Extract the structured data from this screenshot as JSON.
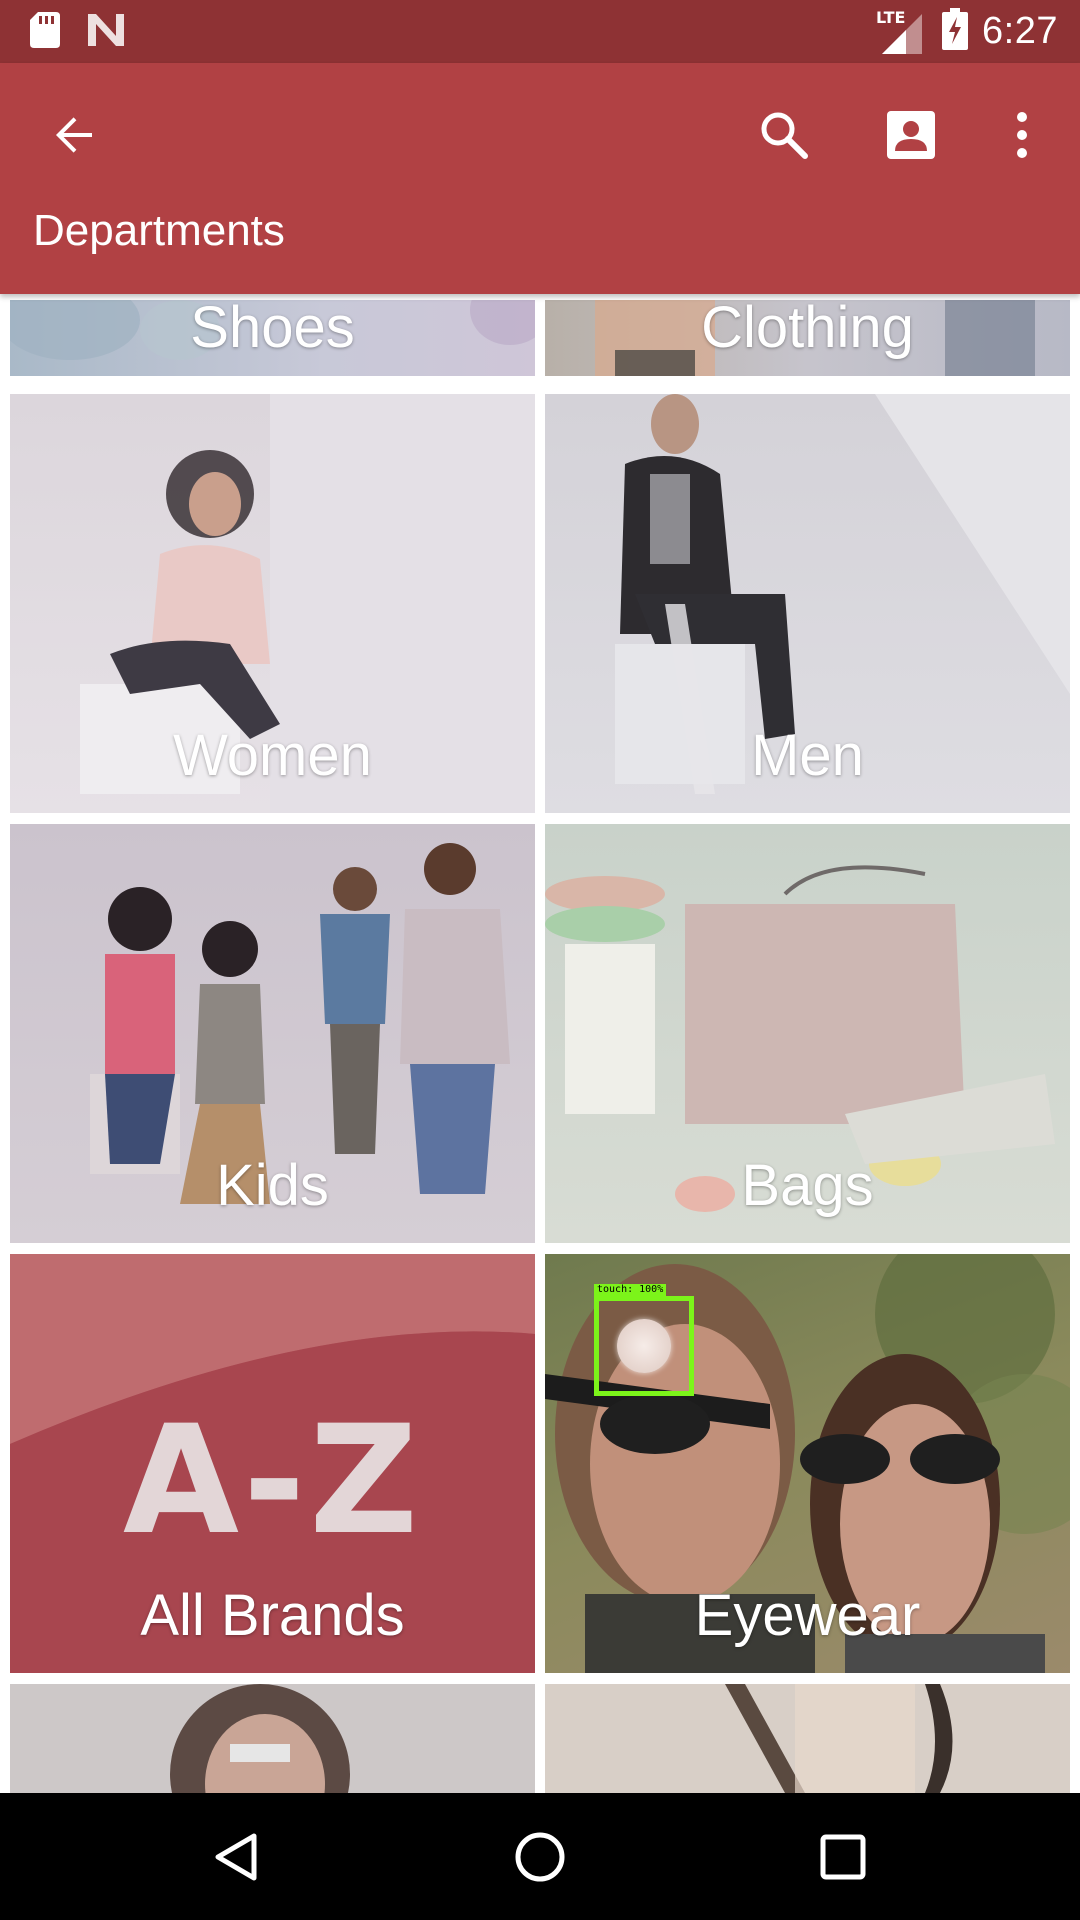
{
  "status_bar": {
    "time": "6:27",
    "network": "LTE",
    "icons": [
      "sd-card-icon",
      "n-notification-icon",
      "signal-icon",
      "battery-charging-icon"
    ]
  },
  "app_bar": {
    "title": "Departments",
    "icons": [
      "back-arrow-icon",
      "search-icon",
      "account-icon",
      "more-vert-icon"
    ],
    "color": "#b14144"
  },
  "departments": [
    {
      "label": "Shoes"
    },
    {
      "label": "Clothing"
    },
    {
      "label": "Women"
    },
    {
      "label": "Men"
    },
    {
      "label": "Kids"
    },
    {
      "label": "Bags"
    },
    {
      "label": "All Brands",
      "art_text": "A-Z"
    },
    {
      "label": "Eyewear"
    }
  ],
  "touch_indicator": {
    "label": "touch: 100%",
    "color": "#7cf41a"
  },
  "nav_bar": {
    "icons": [
      "nav-back-icon",
      "nav-home-icon",
      "nav-recents-icon"
    ]
  }
}
